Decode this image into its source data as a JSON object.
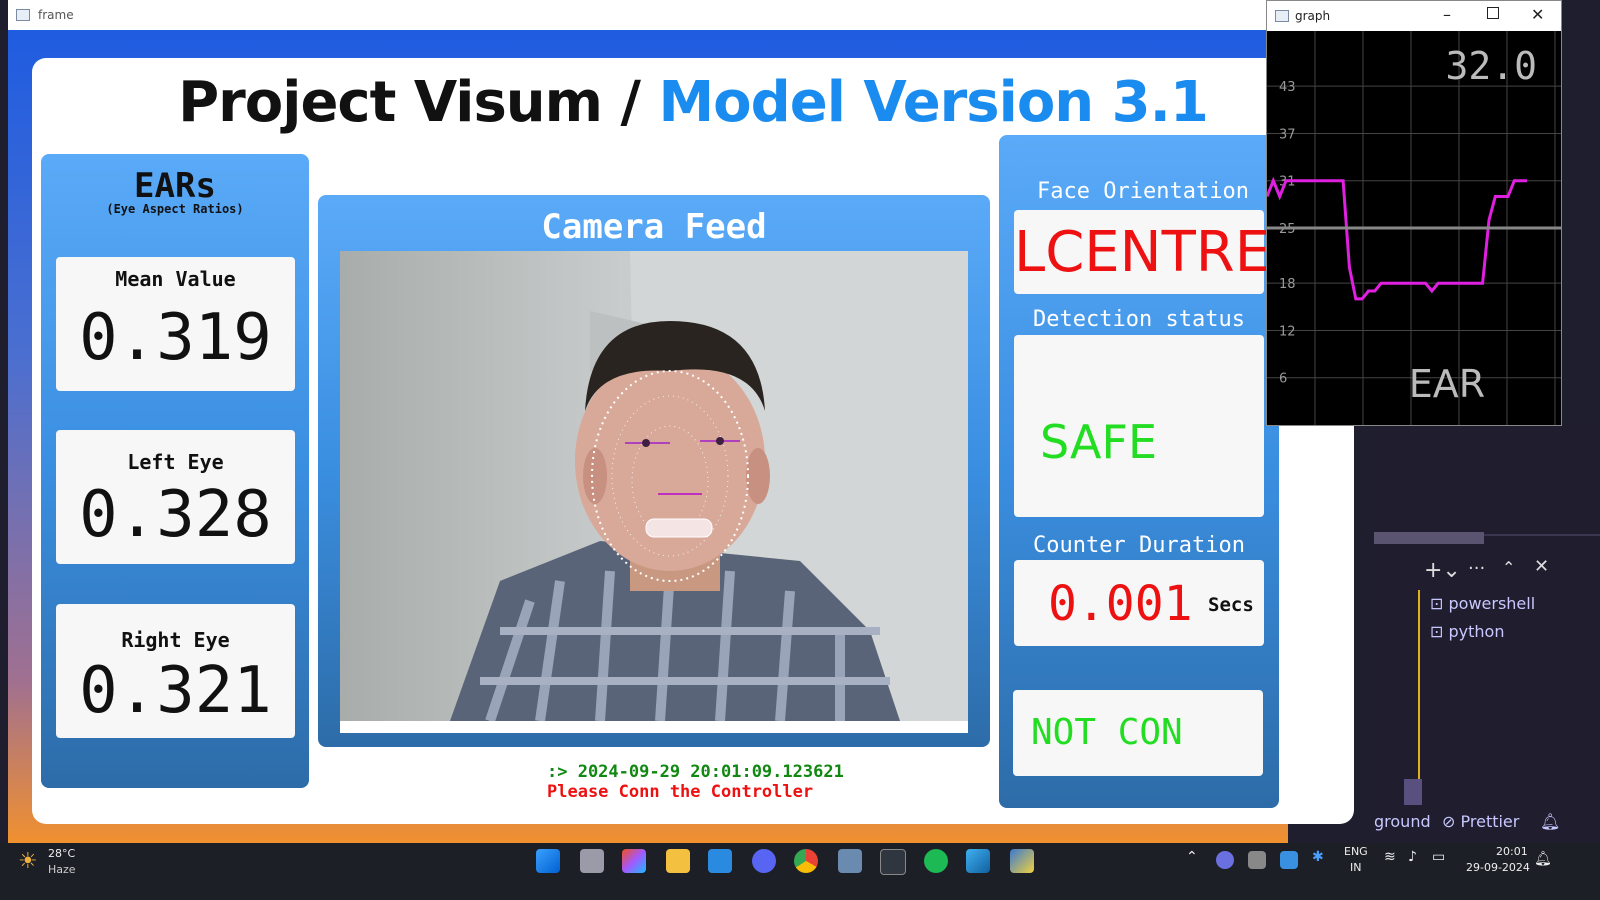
{
  "frame_window": {
    "title": "frame"
  },
  "graph_window": {
    "title": "graph",
    "current_value": "32.0",
    "label": "EAR",
    "y_ticks": [
      "43",
      "37",
      "31",
      "25",
      "18",
      "12",
      "6"
    ],
    "line_color": "#e020e0",
    "threshold_value": 25,
    "ylim": [
      0,
      50
    ],
    "series": [
      29,
      31,
      29,
      31,
      31,
      31,
      31,
      31,
      31,
      31,
      31,
      31,
      31,
      20,
      16,
      16,
      17,
      17,
      18,
      18,
      18,
      18,
      18,
      18,
      18,
      18,
      17,
      18,
      18,
      18,
      18,
      18,
      18,
      18,
      18,
      26,
      29,
      29,
      29,
      31,
      31,
      31
    ]
  },
  "header": {
    "title_main": "Project Visum / ",
    "title_accent": "Model Version 3.1"
  },
  "ears_panel": {
    "title": "EARs",
    "subtitle": "(Eye Aspect Ratios)",
    "mean_label": "Mean Value",
    "mean_value": "0.319",
    "left_label": "Left Eye",
    "left_value": "0.328",
    "right_label": "Right Eye",
    "right_value": "0.321"
  },
  "camera": {
    "title": "Camera Feed"
  },
  "log": {
    "timestamp": ":> 2024-09-29 20:01:09.123621",
    "message": "Please Conn the Controller",
    "timestamp_color": "#118811",
    "message_color": "#ee1111"
  },
  "right_panel": {
    "orientation_label": "Face Orientation",
    "orientation_value": "LCENTRE",
    "detection_label": "Detection status",
    "detection_value": "SAFE",
    "counter_label": "Counter Duration",
    "counter_value": "0.001",
    "counter_unit": "Secs",
    "controller_status": "NOT CON"
  },
  "side_panel": {
    "terminals": [
      "powershell",
      "python"
    ],
    "status_items": [
      "ground",
      "Prettier"
    ]
  },
  "taskbar": {
    "weather_temp": "28°C",
    "weather_desc": "Haze",
    "lang_top": "ENG",
    "lang_bottom": "IN",
    "time": "20:01",
    "date": "29-09-2024"
  }
}
